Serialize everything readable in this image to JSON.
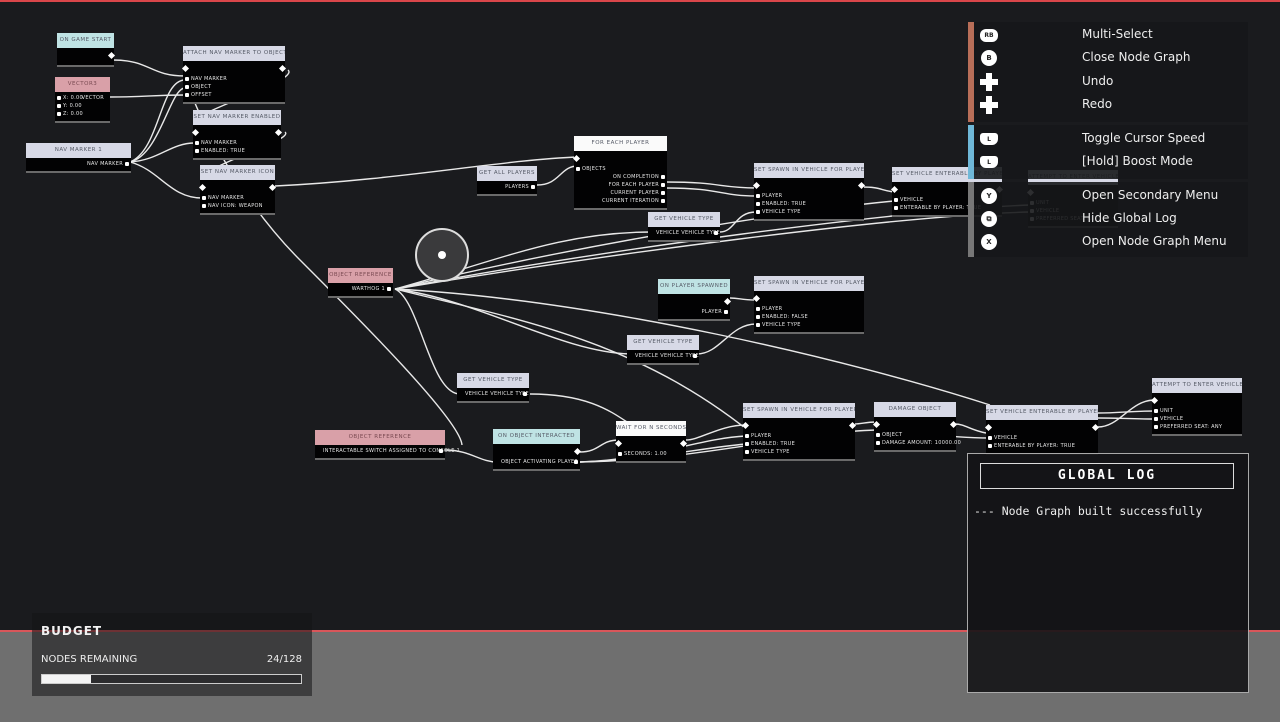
{
  "colors": {
    "accent_red": "#d9464a",
    "event": "#bfe3e4",
    "reference": "#d9a0a8",
    "action": "#d7d9e6",
    "flow": "#fafafa",
    "hint_group_1": "#b86e58",
    "hint_group_2": "#6fb8d8",
    "hint_group_3": "#777777"
  },
  "nodes": [
    {
      "id": "on-game-start",
      "kind": "event",
      "title": "ON GAME START",
      "exec_in": false,
      "exec_out": true,
      "rows": []
    },
    {
      "id": "vectors",
      "kind": "ref",
      "title": "VECTOR3",
      "exec_in": false,
      "exec_out": false,
      "rows": [
        {
          "t": "X: 0.00",
          "io": "in"
        },
        {
          "t": "Y: 0.00",
          "io": "in"
        },
        {
          "t": "Z: 0.00",
          "io": "in"
        }
      ],
      "out": "VECTOR"
    },
    {
      "id": "nav-marker",
      "kind": "action",
      "title": "NAV MARKER 1",
      "exec_in": false,
      "exec_out": false,
      "rows": [
        {
          "t": "NAV MARKER",
          "io": "out"
        }
      ]
    },
    {
      "id": "attach-nav-marker",
      "kind": "action",
      "title": "ATTACH NAV MARKER TO OBJECT",
      "exec_in": true,
      "exec_out": true,
      "rows": [
        {
          "t": "NAV MARKER",
          "io": "in"
        },
        {
          "t": "OBJECT",
          "io": "in"
        },
        {
          "t": "OFFSET",
          "io": "in"
        }
      ]
    },
    {
      "id": "set-nav-marker-enabled",
      "kind": "action",
      "title": "SET NAV MARKER ENABLED",
      "exec_in": true,
      "exec_out": true,
      "rows": [
        {
          "t": "NAV MARKER",
          "io": "in"
        },
        {
          "t": "ENABLED: TRUE",
          "io": "in"
        }
      ]
    },
    {
      "id": "set-nav-marker-icon",
      "kind": "action",
      "title": "SET NAV MARKER ICON",
      "exec_in": true,
      "exec_out": true,
      "rows": [
        {
          "t": "NAV MARKER",
          "io": "in"
        },
        {
          "t": "NAV ICON: WEAPON",
          "io": "in"
        }
      ]
    },
    {
      "id": "get-all-players",
      "kind": "action",
      "title": "GET ALL PLAYERS",
      "exec_in": false,
      "exec_out": false,
      "rows": [
        {
          "t": "PLAYERS",
          "io": "out"
        }
      ]
    },
    {
      "id": "for-each-player",
      "kind": "flow",
      "title": "FOR EACH PLAYER",
      "exec_in": true,
      "exec_out": false,
      "rows": [
        {
          "t": "OBJECTS",
          "io": "in"
        },
        {
          "t": "ON COMPLETION",
          "io": "out"
        },
        {
          "t": "FOR EACH PLAYER",
          "io": "out"
        },
        {
          "t": "CURRENT PLAYER",
          "io": "out"
        },
        {
          "t": "CURRENT ITERATION",
          "io": "out"
        }
      ]
    },
    {
      "id": "set-spawn-in-vehicle-1",
      "kind": "action",
      "title": "SET SPAWN IN VEHICLE FOR PLAYER",
      "exec_in": true,
      "exec_out": true,
      "rows": [
        {
          "t": "PLAYER",
          "io": "in"
        },
        {
          "t": "ENABLED: TRUE",
          "io": "in"
        },
        {
          "t": "VEHICLE TYPE",
          "io": "in"
        }
      ]
    },
    {
      "id": "get-vehicle-type-1",
      "kind": "action",
      "title": "GET VEHICLE TYPE",
      "exec_in": false,
      "exec_out": false,
      "rows": [
        {
          "t": "VEHICLE    VEHICLE TYPE",
          "io": "out"
        }
      ]
    },
    {
      "id": "set-vehicle-enterable-1",
      "kind": "action",
      "title": "SET VEHICLE ENTERABLE BY PLAYER",
      "exec_in": true,
      "exec_out": true,
      "rows": [
        {
          "t": "VEHICLE",
          "io": "in"
        },
        {
          "t": "ENTERABLE BY PLAYER: TRUE",
          "io": "in"
        }
      ]
    },
    {
      "id": "attempt-enter-vehicle-1",
      "kind": "action",
      "title": "ATTEMPT TO ENTER VEHICLE",
      "exec_in": true,
      "exec_out": false,
      "rows": [
        {
          "t": "UNIT",
          "io": "in"
        },
        {
          "t": "VEHICLE",
          "io": "in"
        },
        {
          "t": "PREFERRED SEAT: ANY",
          "io": "in"
        }
      ]
    },
    {
      "id": "object-reference-1",
      "kind": "ref",
      "title": "OBJECT REFERENCE",
      "exec_in": false,
      "exec_out": false,
      "rows": [
        {
          "t": "WARTHOG 1",
          "io": "out"
        }
      ]
    },
    {
      "id": "on-player-spawned",
      "kind": "event",
      "title": "ON PLAYER SPAWNED",
      "exec_in": false,
      "exec_out": true,
      "rows": [
        {
          "t": "PLAYER",
          "io": "out"
        }
      ]
    },
    {
      "id": "set-spawn-in-vehicle-2",
      "kind": "action",
      "title": "SET SPAWN IN VEHICLE FOR PLAYER",
      "exec_in": true,
      "exec_out": false,
      "rows": [
        {
          "t": "PLAYER",
          "io": "in"
        },
        {
          "t": "ENABLED: FALSE",
          "io": "in"
        },
        {
          "t": "VEHICLE TYPE",
          "io": "in"
        }
      ]
    },
    {
      "id": "get-vehicle-type-2",
      "kind": "action",
      "title": "GET VEHICLE TYPE",
      "exec_in": false,
      "exec_out": false,
      "rows": [
        {
          "t": "VEHICLE    VEHICLE TYPE",
          "io": "out"
        }
      ]
    },
    {
      "id": "get-vehicle-type-3",
      "kind": "action",
      "title": "GET VEHICLE TYPE",
      "exec_in": false,
      "exec_out": false,
      "rows": [
        {
          "t": "VEHICLE    VEHICLE TYPE",
          "io": "out"
        }
      ]
    },
    {
      "id": "object-reference-2",
      "kind": "ref",
      "title": "OBJECT REFERENCE",
      "exec_in": false,
      "exec_out": false,
      "rows": [
        {
          "t": "INTERACTABLE SWITCH ASSIGNED TO CONSOLE 1",
          "io": "out"
        }
      ]
    },
    {
      "id": "on-object-interacted",
      "kind": "event",
      "title": "ON OBJECT INTERACTED",
      "exec_in": false,
      "exec_out": true,
      "rows": [
        {
          "t": "OBJECT    ACTIVATING PLAYER",
          "io": "out"
        }
      ]
    },
    {
      "id": "wait-for-n-seconds",
      "kind": "flow",
      "title": "WAIT FOR N SECONDS",
      "exec_in": true,
      "exec_out": true,
      "rows": [
        {
          "t": "SECONDS: 1.00",
          "io": "in"
        }
      ]
    },
    {
      "id": "set-spawn-in-vehicle-3",
      "kind": "action",
      "title": "SET SPAWN IN VEHICLE FOR PLAYER",
      "exec_in": true,
      "exec_out": true,
      "rows": [
        {
          "t": "PLAYER",
          "io": "in"
        },
        {
          "t": "ENABLED: TRUE",
          "io": "in"
        },
        {
          "t": "VEHICLE TYPE",
          "io": "in"
        }
      ]
    },
    {
      "id": "damage-object",
      "kind": "action",
      "title": "DAMAGE OBJECT",
      "exec_in": true,
      "exec_out": true,
      "rows": [
        {
          "t": "OBJECT",
          "io": "in"
        },
        {
          "t": "DAMAGE AMOUNT: 10000.00",
          "io": "in"
        }
      ]
    },
    {
      "id": "set-vehicle-enterable-2",
      "kind": "action",
      "title": "SET VEHICLE ENTERABLE BY PLAYER",
      "exec_in": true,
      "exec_out": true,
      "rows": [
        {
          "t": "VEHICLE",
          "io": "in"
        },
        {
          "t": "ENTERABLE BY PLAYER: TRUE",
          "io": "in"
        }
      ]
    },
    {
      "id": "attempt-enter-vehicle-2",
      "kind": "action",
      "title": "ATTEMPT TO ENTER VEHICLE",
      "exec_in": true,
      "exec_out": false,
      "rows": [
        {
          "t": "UNIT",
          "io": "in"
        },
        {
          "t": "VEHICLE",
          "io": "in"
        },
        {
          "t": "PREFERRED SEAT: ANY",
          "io": "in"
        }
      ]
    }
  ],
  "hints": [
    {
      "icon": "rb-button",
      "glyph": "RB",
      "label": "Multi-Select"
    },
    {
      "icon": "b-button",
      "glyph": "B",
      "label": "Close Node Graph"
    },
    {
      "icon": "dpad-down",
      "glyph": "",
      "label": "Undo"
    },
    {
      "icon": "dpad-up",
      "glyph": "",
      "label": "Redo"
    },
    {
      "icon": "left-stick-click",
      "glyph": "L",
      "label": "Toggle Cursor Speed"
    },
    {
      "icon": "left-stick-click",
      "glyph": "L",
      "label": "[Hold] Boost Mode"
    },
    {
      "icon": "y-button",
      "glyph": "Y",
      "label": "Open Secondary Menu"
    },
    {
      "icon": "view-button",
      "glyph": "⧉",
      "label": "Hide Global Log"
    },
    {
      "icon": "x-button",
      "glyph": "X",
      "label": "Open Node Graph Menu"
    }
  ],
  "budget": {
    "title": "BUDGET",
    "label": "NODES REMAINING",
    "value": "24/128",
    "remaining": 24,
    "total": 128
  },
  "global_log": {
    "title": "GLOBAL LOG",
    "messages": [
      "--- Node Graph built successfully"
    ]
  }
}
